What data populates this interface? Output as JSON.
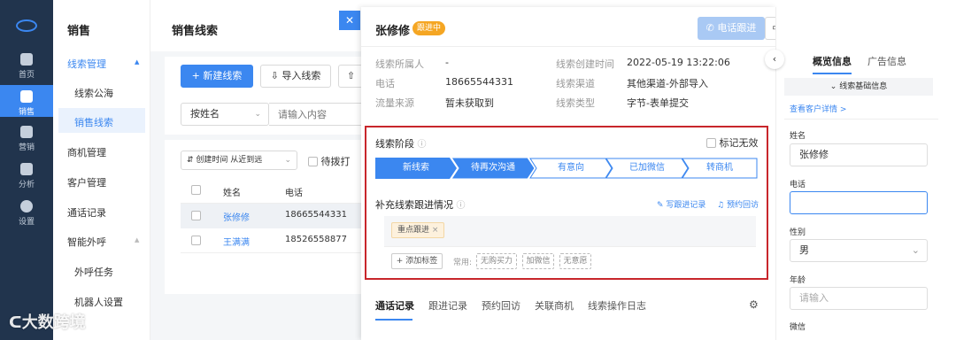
{
  "rail": {
    "home": "首页",
    "sales": "销售",
    "marketing": "营销",
    "analysis": "分析",
    "settings": "设置"
  },
  "nav": {
    "title": "销售",
    "items": {
      "clue_mgmt": "线索管理",
      "clue_pool": "线索公海",
      "sales_clue": "销售线索",
      "biz_mgmt": "商机管理",
      "customer_mgmt": "客户管理",
      "call_record": "通话记录",
      "smart_call": "智能外呼",
      "outbound_task": "外呼任务",
      "robot_settings": "机器人设置"
    }
  },
  "list": {
    "title": "销售线索",
    "new_btn": "+ 新建线索",
    "import_btn": "导入线索",
    "filter_by": "按姓名",
    "search_placeholder": "请输入内容",
    "sort": "创建时间 从近到远",
    "pending": "待拨打",
    "col_name": "姓名",
    "col_phone": "电话",
    "rows": [
      {
        "name": "张修修",
        "phone": "18665544331"
      },
      {
        "name": "王满满",
        "phone": "18526558877"
      }
    ]
  },
  "detail": {
    "name": "张修修",
    "status_badge": "跟进中",
    "call_btn": "电话跟进",
    "assign_btn": "分配",
    "more": "···",
    "owner_label": "线索所属人",
    "owner_value": "-",
    "created_label": "线索创建时间",
    "created_value": "2022-05-19 13:22:06",
    "phone_label": "电话",
    "phone_value": "18665544331",
    "channel_label": "线索渠道",
    "channel_value": "其他渠道-外部导入",
    "source_label": "流量来源",
    "source_value": "暂未获取到",
    "type_label": "线索类型",
    "type_value": "字节-表单提交",
    "stage_title": "线索阶段",
    "mark_invalid": "标记无效",
    "stages": [
      "新线索",
      "待再次沟通",
      "有意向",
      "已加微信",
      "转商机"
    ],
    "followup_title": "补充线索跟进情况",
    "write_record": "写跟进记录",
    "book_revisit": "预约回访",
    "selected_tag": "重点跟进",
    "add_tag": "+ 添加标签",
    "common_label": "常用:",
    "common_tags": [
      "无购买力",
      "加微信",
      "无意愿"
    ],
    "tabs": [
      "通话记录",
      "跟进记录",
      "预约回访",
      "关联商机",
      "线索操作日志"
    ]
  },
  "right": {
    "tab_overview": "概览信息",
    "tab_ads": "广告信息",
    "section": "线索基础信息",
    "view_customer": "查看客户详情 >",
    "name_label": "姓名",
    "name_value": "张修修",
    "phone_label": "电话",
    "gender_label": "性别",
    "gender_value": "男",
    "age_label": "年龄",
    "age_placeholder": "请输入",
    "wechat_label": "微信"
  },
  "watermark": "大数跨境",
  "colors": {
    "primary": "#3b87f0",
    "rail": "#21344d",
    "badge": "#f5a623",
    "highlight": "#c8262b"
  }
}
